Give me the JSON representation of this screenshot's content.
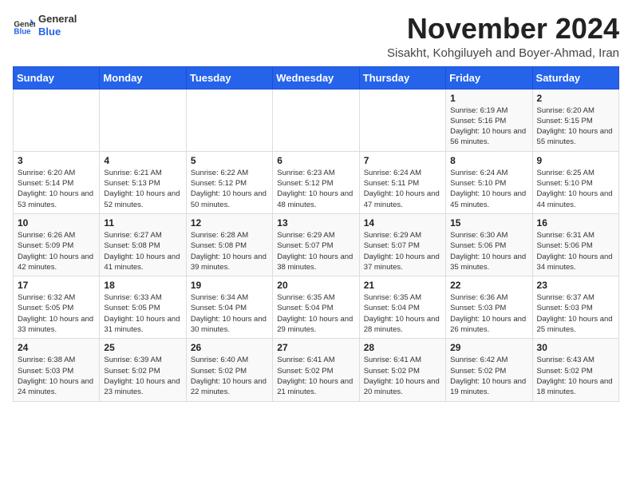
{
  "header": {
    "logo_general": "General",
    "logo_blue": "Blue",
    "month_title": "November 2024",
    "subtitle": "Sisakht, Kohgiluyeh and Boyer-Ahmad, Iran"
  },
  "weekdays": [
    "Sunday",
    "Monday",
    "Tuesday",
    "Wednesday",
    "Thursday",
    "Friday",
    "Saturday"
  ],
  "weeks": [
    [
      {
        "day": "",
        "info": ""
      },
      {
        "day": "",
        "info": ""
      },
      {
        "day": "",
        "info": ""
      },
      {
        "day": "",
        "info": ""
      },
      {
        "day": "",
        "info": ""
      },
      {
        "day": "1",
        "info": "Sunrise: 6:19 AM\nSunset: 5:16 PM\nDaylight: 10 hours and 56 minutes."
      },
      {
        "day": "2",
        "info": "Sunrise: 6:20 AM\nSunset: 5:15 PM\nDaylight: 10 hours and 55 minutes."
      }
    ],
    [
      {
        "day": "3",
        "info": "Sunrise: 6:20 AM\nSunset: 5:14 PM\nDaylight: 10 hours and 53 minutes."
      },
      {
        "day": "4",
        "info": "Sunrise: 6:21 AM\nSunset: 5:13 PM\nDaylight: 10 hours and 52 minutes."
      },
      {
        "day": "5",
        "info": "Sunrise: 6:22 AM\nSunset: 5:12 PM\nDaylight: 10 hours and 50 minutes."
      },
      {
        "day": "6",
        "info": "Sunrise: 6:23 AM\nSunset: 5:12 PM\nDaylight: 10 hours and 48 minutes."
      },
      {
        "day": "7",
        "info": "Sunrise: 6:24 AM\nSunset: 5:11 PM\nDaylight: 10 hours and 47 minutes."
      },
      {
        "day": "8",
        "info": "Sunrise: 6:24 AM\nSunset: 5:10 PM\nDaylight: 10 hours and 45 minutes."
      },
      {
        "day": "9",
        "info": "Sunrise: 6:25 AM\nSunset: 5:10 PM\nDaylight: 10 hours and 44 minutes."
      }
    ],
    [
      {
        "day": "10",
        "info": "Sunrise: 6:26 AM\nSunset: 5:09 PM\nDaylight: 10 hours and 42 minutes."
      },
      {
        "day": "11",
        "info": "Sunrise: 6:27 AM\nSunset: 5:08 PM\nDaylight: 10 hours and 41 minutes."
      },
      {
        "day": "12",
        "info": "Sunrise: 6:28 AM\nSunset: 5:08 PM\nDaylight: 10 hours and 39 minutes."
      },
      {
        "day": "13",
        "info": "Sunrise: 6:29 AM\nSunset: 5:07 PM\nDaylight: 10 hours and 38 minutes."
      },
      {
        "day": "14",
        "info": "Sunrise: 6:29 AM\nSunset: 5:07 PM\nDaylight: 10 hours and 37 minutes."
      },
      {
        "day": "15",
        "info": "Sunrise: 6:30 AM\nSunset: 5:06 PM\nDaylight: 10 hours and 35 minutes."
      },
      {
        "day": "16",
        "info": "Sunrise: 6:31 AM\nSunset: 5:06 PM\nDaylight: 10 hours and 34 minutes."
      }
    ],
    [
      {
        "day": "17",
        "info": "Sunrise: 6:32 AM\nSunset: 5:05 PM\nDaylight: 10 hours and 33 minutes."
      },
      {
        "day": "18",
        "info": "Sunrise: 6:33 AM\nSunset: 5:05 PM\nDaylight: 10 hours and 31 minutes."
      },
      {
        "day": "19",
        "info": "Sunrise: 6:34 AM\nSunset: 5:04 PM\nDaylight: 10 hours and 30 minutes."
      },
      {
        "day": "20",
        "info": "Sunrise: 6:35 AM\nSunset: 5:04 PM\nDaylight: 10 hours and 29 minutes."
      },
      {
        "day": "21",
        "info": "Sunrise: 6:35 AM\nSunset: 5:04 PM\nDaylight: 10 hours and 28 minutes."
      },
      {
        "day": "22",
        "info": "Sunrise: 6:36 AM\nSunset: 5:03 PM\nDaylight: 10 hours and 26 minutes."
      },
      {
        "day": "23",
        "info": "Sunrise: 6:37 AM\nSunset: 5:03 PM\nDaylight: 10 hours and 25 minutes."
      }
    ],
    [
      {
        "day": "24",
        "info": "Sunrise: 6:38 AM\nSunset: 5:03 PM\nDaylight: 10 hours and 24 minutes."
      },
      {
        "day": "25",
        "info": "Sunrise: 6:39 AM\nSunset: 5:02 PM\nDaylight: 10 hours and 23 minutes."
      },
      {
        "day": "26",
        "info": "Sunrise: 6:40 AM\nSunset: 5:02 PM\nDaylight: 10 hours and 22 minutes."
      },
      {
        "day": "27",
        "info": "Sunrise: 6:41 AM\nSunset: 5:02 PM\nDaylight: 10 hours and 21 minutes."
      },
      {
        "day": "28",
        "info": "Sunrise: 6:41 AM\nSunset: 5:02 PM\nDaylight: 10 hours and 20 minutes."
      },
      {
        "day": "29",
        "info": "Sunrise: 6:42 AM\nSunset: 5:02 PM\nDaylight: 10 hours and 19 minutes."
      },
      {
        "day": "30",
        "info": "Sunrise: 6:43 AM\nSunset: 5:02 PM\nDaylight: 10 hours and 18 minutes."
      }
    ]
  ]
}
